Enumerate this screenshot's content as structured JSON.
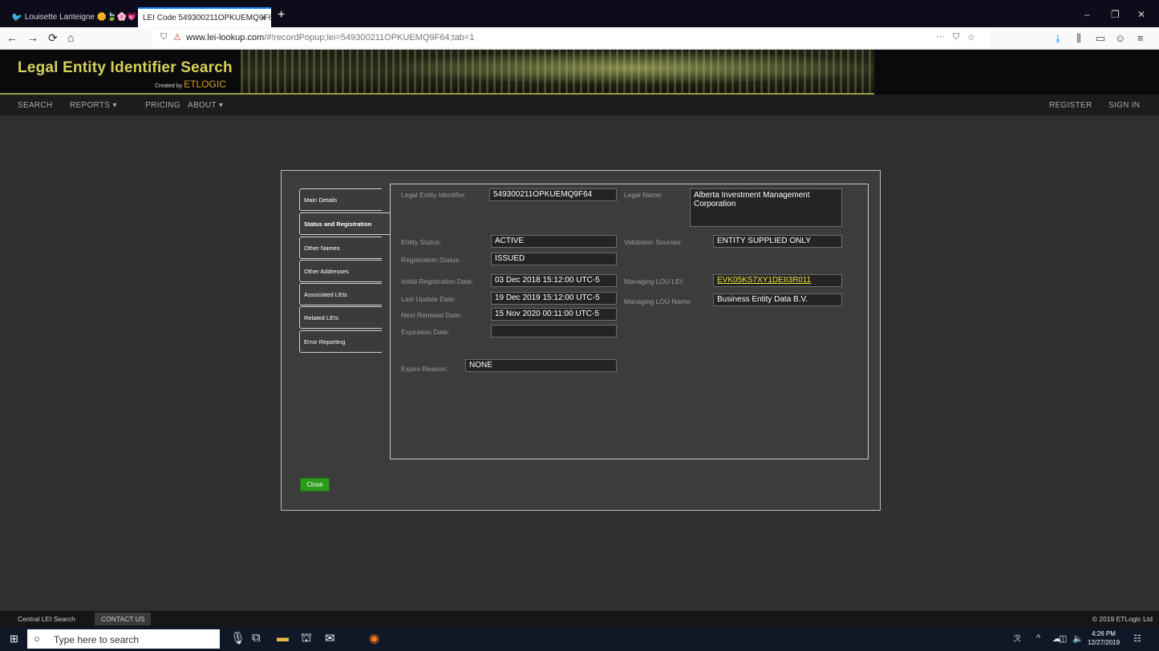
{
  "browser": {
    "tabs": [
      {
        "label": "Louisette Lanteigne 🌼🍃🌸💗 ·"
      },
      {
        "label": "LEI Code 549300211OPKUEMQ9F64"
      }
    ],
    "tab_close": "×",
    "new_tab": "+",
    "window_controls": {
      "minimize": "–",
      "restore": "❐",
      "close": "✕"
    },
    "nav": {
      "back": "←",
      "forward": "→",
      "reload": "⟳",
      "home": "⌂"
    },
    "url_domain": "www.lei-lookup.com",
    "url_path": "/#!recordPopup;lei=549300211OPKUEMQ9F64;tab=1",
    "url_shield": "⛉",
    "url_icons": {
      "more": "···",
      "pocket": "⛉",
      "star": "☆"
    },
    "toolbar_icons": {
      "download": "⤓",
      "library": "⫼",
      "reader": "▭",
      "account": "☺",
      "menu": "≡"
    }
  },
  "site": {
    "title": "Legal Entity Identifier Search",
    "created_by": "Created by",
    "company": "ETLOGIC",
    "nav": {
      "search": "SEARCH",
      "reports": "REPORTS ▾",
      "pricing": "PRICING",
      "about": "ABOUT ▾",
      "register": "REGISTER",
      "sign_in": "SIGN IN"
    }
  },
  "modal": {
    "tabs": [
      {
        "label": "Main Details"
      },
      {
        "label": "Status and Registration"
      },
      {
        "label": "Other Names"
      },
      {
        "label": "Other Addresses"
      },
      {
        "label": "Associated LEIs"
      },
      {
        "label": "Related LEIs"
      },
      {
        "label": "Error Reporting"
      }
    ],
    "fields": {
      "lei_label": "Legal Entity Identifier:",
      "lei_value": "549300211OPKUEMQ9F64",
      "legal_name_label": "Legal Name:",
      "legal_name_value": "Alberta Investment Management Corporation",
      "entity_status_label": "Entity Status:",
      "entity_status_value": "ACTIVE",
      "validation_sources_label": "Validation Sources:",
      "validation_sources_value": "ENTITY SUPPLIED ONLY",
      "registration_status_label": "Registration Status:",
      "registration_status_value": "ISSUED",
      "initial_registration_label": "Initial Registration Date:",
      "initial_registration_value": "03 Dec 2018 15:12:00 UTC-5",
      "managing_lou_lei_label": "Managing LOU LEI:",
      "managing_lou_lei_value": "EVK05KS7XY1DEII3R011",
      "last_update_label": "Last Update Date:",
      "last_update_value": "19 Dec 2019 15:12:00 UTC-5",
      "managing_lou_name_label": "Managing LOU Name:",
      "managing_lou_name_value": "Business Entity Data B.V.",
      "next_renewal_label": "Next Renewal Date:",
      "next_renewal_value": "15 Nov 2020 00:11:00 UTC-5",
      "expiration_label": "Expiration Date:",
      "expiration_value": "",
      "expire_reason_label": "Expire Reason:",
      "expire_reason_value": "NONE"
    },
    "close_label": "Close"
  },
  "footer": {
    "central": "Central LEI Search",
    "contact": "CONTACT US",
    "copyright": "© 2019 ETLogic Ltd"
  },
  "taskbar": {
    "start_icon": "⊞",
    "search_placeholder": "Type here to search",
    "search_ring": "○",
    "icons": {
      "mic": "🎙",
      "taskview": "⧉",
      "explorer": "▬",
      "store": "⛫",
      "mail": "✉",
      "firefox": "◉"
    },
    "tray": {
      "people": "ℛ",
      "chevron": "^",
      "network": "☁",
      "battery": "▭",
      "wifi": "◫",
      "volume": "🔈",
      "notifications": "☷"
    },
    "time": "4:26 PM",
    "date": "12/27/2019"
  }
}
